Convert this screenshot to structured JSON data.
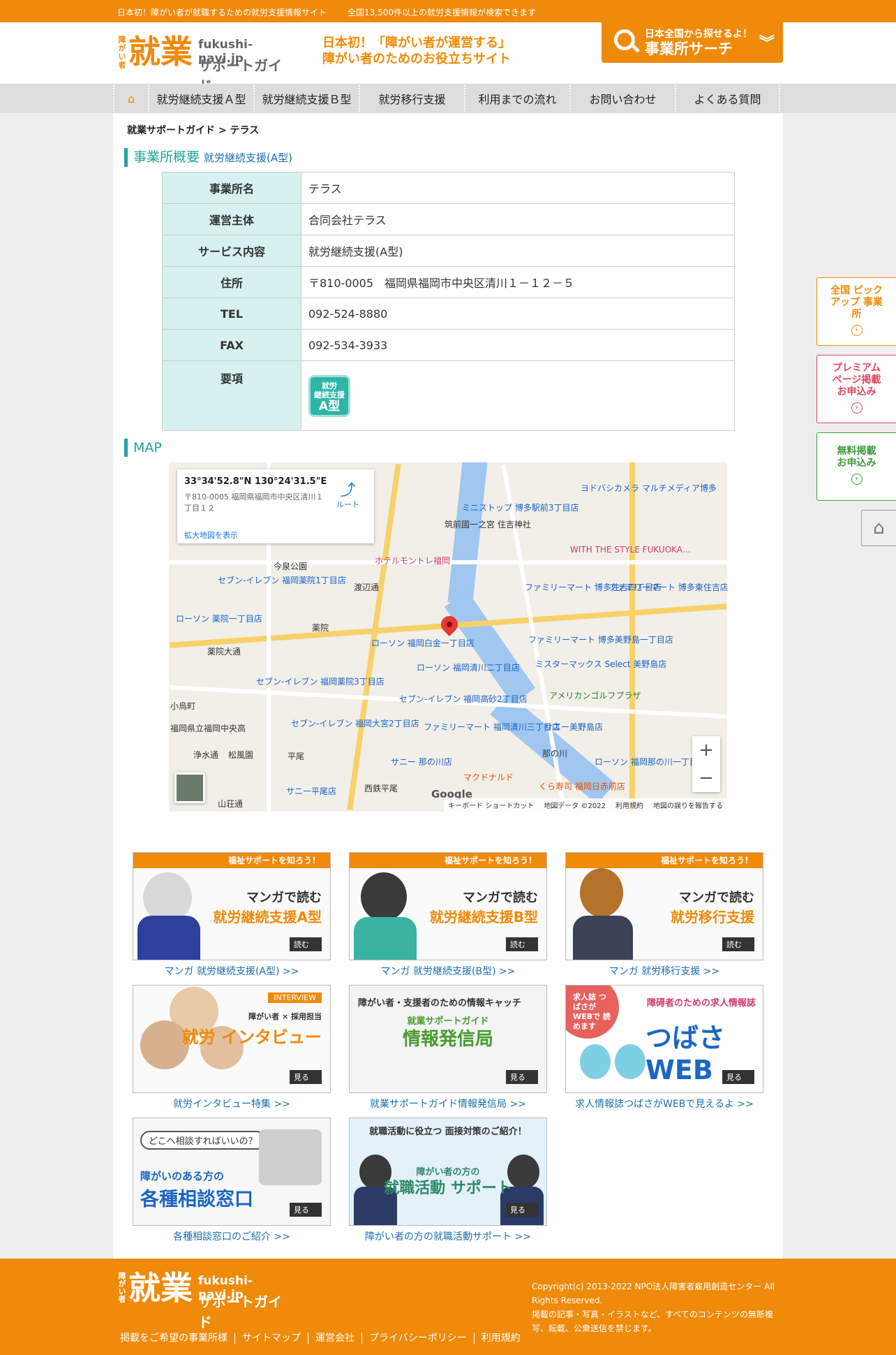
{
  "topbar": {
    "left": "日本初！障がい者が就職するための就労支援情報サイト",
    "right": "全国13,500件以上の就労支援情報が検索できます"
  },
  "header": {
    "logo_vertical": "障がい者",
    "logo_main": "就業",
    "logo_domain": "fukushi-navi.jp",
    "logo_sub": "サポートガイド",
    "tagline_1": "日本初！「障がい者が運営する」",
    "tagline_2": "障がい者のためのお役立ちサイト",
    "search_line1": "日本全国から探せるよ！",
    "search_line2": "事業所サーチ"
  },
  "nav": {
    "items": [
      "就労継続支援Ａ型",
      "就労継続支援Ｂ型",
      "就労移行支援",
      "利用までの流れ",
      "お問い合わせ",
      "よくある質問"
    ]
  },
  "breadcrumb": "就業サポートガイド > テラス",
  "overview": {
    "title": "事業所概要",
    "subtitle": "就労継続支援(A型)",
    "rows": [
      {
        "label": "事業所名",
        "value": "テラス"
      },
      {
        "label": "運営主体",
        "value": "合同会社テラス"
      },
      {
        "label": "サービス内容",
        "value": "就労継続支援(A型)"
      },
      {
        "label": "住所",
        "value": "〒810-0005　福岡県福岡市中央区清川１－１２－５"
      },
      {
        "label": "TEL",
        "value": "092-524-8880"
      },
      {
        "label": "FAX",
        "value": "092-534-3933"
      },
      {
        "label": "要項",
        "value": ""
      }
    ],
    "badge_line1": "就労",
    "badge_line2": "継続支援",
    "badge_line3": "A型"
  },
  "map": {
    "title": "MAP",
    "coord": "33°34'52.8\"N 130°24'31.5\"E",
    "address": "〒810-0005 福岡県福岡市中央区清川１丁目１２",
    "bigger": "拡大地図を表示",
    "route": "ルート",
    "google": "Google",
    "footer": [
      "キーボード ショートカット",
      "地図データ ©2022",
      "利用規約",
      "地図の誤りを報告する"
    ],
    "labels": [
      "ミニストップ 博多駅前3丁目店",
      "ヨドバシカメラ マルチメディア博多",
      "筑前國一之宮 住吉神社",
      "今泉公園",
      "ホテルモントレ福岡",
      "WITH THE STYLE FUKUOKA…",
      "セブン-イレブン 福岡薬院1丁目店",
      "渡辺通",
      "ファミリーマート 博多住吉四丁目店",
      "ファミリーマート 博多東住吉店",
      "ローソン 薬院一丁目店",
      "薬院",
      "ローソン 福岡白金一丁目店",
      "ファミリーマート 博多美野島一丁目店",
      "薬院大通",
      "ローソン 福岡清川二丁目店",
      "ミスターマックス Select 美野島店",
      "セブン-イレブン 福岡薬院3丁目店",
      "アメリカンゴルフプラザ",
      "セブン-イレブン 福岡高砂2丁目店",
      "小烏町",
      "セブン-イレブン 福岡大宮2丁目店",
      "ファミリーマート 福岡清川三丁目店",
      "サニー美野島店",
      "福岡県立福岡中央高",
      "那の川",
      "浄水通",
      "松風園",
      "平尾",
      "サニー 那の川店",
      "ローソン 福岡那の川一丁目店",
      "マクドナルド",
      "くら寿司 福岡日赤前店",
      "西鉄平尾",
      "サニー平尾店",
      "山荘通"
    ]
  },
  "banners": [
    {
      "ribbon": "福祉サポートを知ろう！",
      "title1": "マンガで読む",
      "title2": "就労継続支援A型",
      "read": "読む",
      "caption": "マンガ 就労継続支援(A型) >>"
    },
    {
      "ribbon": "福祉サポートを知ろう！",
      "title1": "マンガで読む",
      "title2": "就労継続支援B型",
      "read": "読む",
      "caption": "マンガ 就労継続支援(B型) >>"
    },
    {
      "ribbon": "福祉サポートを知ろう！",
      "title1": "マンガで読む",
      "title2": "就労移行支援",
      "read": "読む",
      "caption": "マンガ 就労移行支援 >>"
    },
    {
      "ribbon": "INTERVIEW",
      "title1": "障がい者 × 採用担当",
      "title2": "就労 インタビュー",
      "read": "見る",
      "caption": "就労インタビュー特集 >>"
    },
    {
      "ribbon": "障がい者・支援者のための情報キャッチ",
      "title1": "就業サポートガイド",
      "title2": "情報発信局",
      "read": "見る",
      "caption": "就業サポートガイド情報発信局 >>"
    },
    {
      "ribbon": "障碍者のための求人情報誌",
      "title1": "求人誌 つばさが WEBで 読めます",
      "title2": "つばさ WEB",
      "read": "見る",
      "caption": "求人情報誌つばさがWEBで見えるよ >>"
    },
    {
      "ribbon": "どこへ相談すればいいの？",
      "title1": "障がいのある方の",
      "title2": "各種相談窓口",
      "read": "見る",
      "caption": "各種相談窓口のご紹介 >>"
    },
    {
      "ribbon": "就職活動に役立つ 面接対策のご紹介！",
      "title1": "障がい者の方の",
      "title2": "就職活動 サポート",
      "read": "見る",
      "caption": "障がい者の方の就職活動サポート >>"
    }
  ],
  "side": {
    "btn1": "全国 ピックアップ 事業所",
    "btn2": "プレミアム ページ掲載 お申込み",
    "btn3": "無料掲載 お申込み"
  },
  "footer": {
    "links": [
      "掲載をご希望の事業所様",
      "サイトマップ",
      "運営会社",
      "プライバシーポリシー",
      "利用規約"
    ],
    "copyright": "Copyright(c) 2013-2022 NPO法人障害者雇用創造センター All Rights Reserved.",
    "notice": "掲載の記事・写真・イラストなど、すべてのコンテンツの無断複写、転載、公衆送信を禁じます。"
  },
  "colors": {
    "brand": "#ef8a0a",
    "teal": "#22a39a",
    "link": "#1a6fb0"
  }
}
